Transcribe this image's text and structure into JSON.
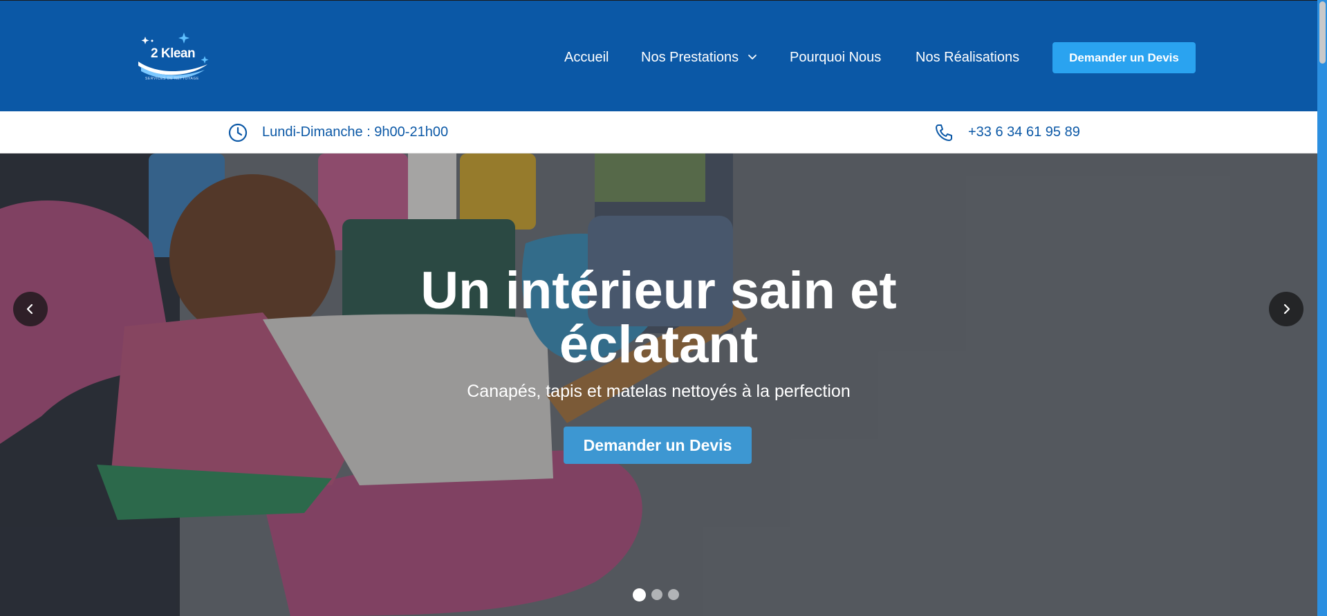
{
  "brand": {
    "name": "2 Klean",
    "tagline": "SERVICES DE NETTOYAGE"
  },
  "nav": {
    "items": [
      {
        "label": "Accueil"
      },
      {
        "label": "Nos Prestations",
        "has_dropdown": true
      },
      {
        "label": "Pourquoi Nous"
      },
      {
        "label": "Nos Réalisations"
      }
    ],
    "cta_label": "Demander un Devis"
  },
  "infobar": {
    "hours": "Lundi-Dimanche : 9h00-21h00",
    "phone": "+33 6 34 61 95 89",
    "hours_icon": "clock-icon",
    "phone_icon": "phone-icon"
  },
  "hero": {
    "title_line1": "Un intérieur sain et",
    "title_line2": "éclatant",
    "subtitle": "Canapés, tapis et matelas nettoyés à la perfection",
    "cta_label": "Demander un Devis",
    "slides": {
      "count": 3,
      "active": 1
    }
  },
  "colors": {
    "header_bg": "#0b58a6",
    "accent": "#2aa3f0",
    "hero_cta": "#3d97d2",
    "text_blue": "#0b58a6"
  }
}
